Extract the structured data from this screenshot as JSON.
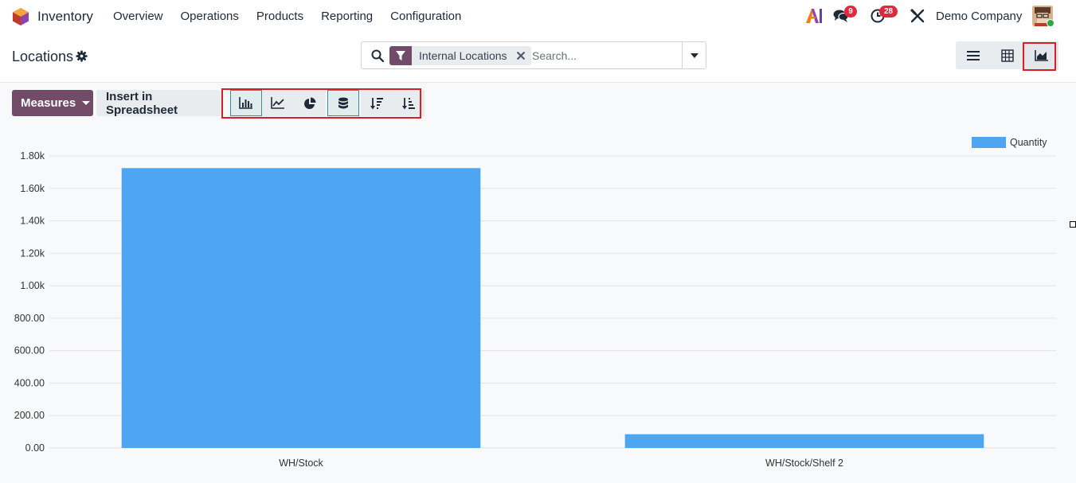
{
  "app": {
    "name": "Inventory"
  },
  "menu": [
    {
      "label": "Overview"
    },
    {
      "label": "Operations"
    },
    {
      "label": "Products"
    },
    {
      "label": "Reporting"
    },
    {
      "label": "Configuration"
    }
  ],
  "systray": {
    "messages_count": "9",
    "activities_count": "28",
    "company": "Demo Company"
  },
  "breadcrumb": {
    "title": "Locations"
  },
  "search": {
    "facet_label": "Internal Locations",
    "placeholder": "Search..."
  },
  "toolbar": {
    "measures_label": "Measures",
    "insert_label": "Insert in Spreadsheet"
  },
  "colors": {
    "brand": "#714b67",
    "bar": "#4ea6f3",
    "badge": "#e0293c",
    "highlight": "#d62027"
  },
  "icons": [
    "app-logo-icon",
    "search-icon",
    "filter-icon",
    "close-icon",
    "caret-down-icon",
    "list-view-icon",
    "pivot-view-icon",
    "graph-view-icon",
    "bar-chart-icon",
    "line-chart-icon",
    "pie-chart-icon",
    "stacked-icon",
    "sort-descending-icon",
    "sort-ascending-icon",
    "gear-icon",
    "chat-icon",
    "clock-icon",
    "tools-icon"
  ],
  "chart_data": {
    "type": "bar",
    "categories": [
      "WH/Stock",
      "WH/Stock/Shelf 2"
    ],
    "series": [
      {
        "name": "Quantity",
        "values": [
          1725,
          85
        ]
      }
    ],
    "ylim": [
      0,
      1800
    ],
    "yticks": [
      "0.00",
      "200.00",
      "400.00",
      "600.00",
      "800.00",
      "1.00k",
      "1.20k",
      "1.40k",
      "1.60k",
      "1.80k"
    ],
    "grid": true,
    "legend": "top-right",
    "xlabel": "",
    "ylabel": ""
  }
}
